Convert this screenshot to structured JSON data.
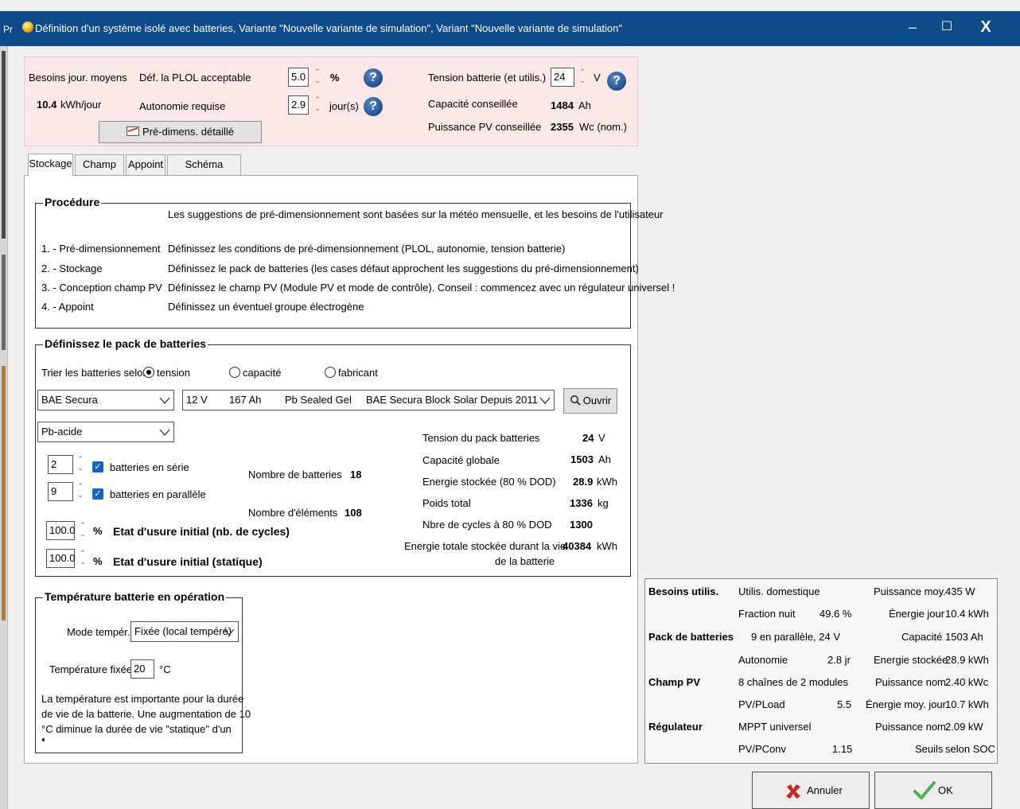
{
  "window": {
    "title": "Définition d'un système isolé avec batteries, Variante  \"Nouvelle variante de simulation\", Variant  \"Nouvelle variante de simulation\"",
    "minimize": "–",
    "maximize": "☐",
    "close": "X",
    "left_clip": "Pr"
  },
  "header": {
    "needs_label": "Besoins jour. moyens",
    "needs_value": "10.4",
    "needs_unit": "kWh/jour",
    "plol_label": "Déf. la PLOL acceptable",
    "plol_value": "5.0",
    "plol_unit": "%",
    "autonomy_label": "Autonomie requise",
    "autonomy_value": "2.9",
    "autonomy_unit": "jour(s)",
    "predim_button": "Pré-dimens. détaillé",
    "voltage_label": "Tension batterie (et utilis.)",
    "voltage_value": "24",
    "voltage_unit": "V",
    "capacity_label": "Capacité conseillée",
    "capacity_value": "1484",
    "capacity_unit": "Ah",
    "pv_label": "Puissance PV conseillée",
    "pv_value": "2355",
    "pv_unit": "Wc (nom.)"
  },
  "tabs": [
    "Stockage",
    "Champ PV",
    "Appoint",
    "Schéma simplifié"
  ],
  "procedure": {
    "legend": "Procédure",
    "intro": "Les suggestions de pré-dimensionnement sont basées sur la météo mensuelle, et les besoins de l'utilisateur",
    "steps": [
      {
        "label": "1. - Pré-dimensionnement",
        "text": "Définissez les conditions de pré-dimensionnement (PLOL, autonomie, tension batterie)"
      },
      {
        "label": "2. - Stockage",
        "text": "Définissez le pack de batteries (les cases défaut approchent les suggestions du pré-dimensionnement)"
      },
      {
        "label": "3. - Conception champ PV",
        "text": "Définissez le champ PV (Module PV et mode de contrôle). Conseil : commencez avec un régulateur universel !"
      },
      {
        "label": "4. - Appoint",
        "text": "Définissez un éventuel groupe électrogène"
      }
    ]
  },
  "battery": {
    "legend": "Définissez le pack de batteries",
    "sort_label": "Trier les batteries selon",
    "sort_options": [
      "tension",
      "capacité",
      "fabricant"
    ],
    "manufacturer": "BAE Secura",
    "model_voltage": "12 V",
    "model_capacity": "167 Ah",
    "model_tech": "Pb  Sealed  Gel",
    "model_name": "BAE Secura Block Solar  Depuis 2011",
    "open_button": "Ouvrir",
    "technology": "Pb-acide",
    "series_value": "2",
    "series_label": "batteries en série",
    "parallel_value": "9",
    "parallel_label": "batteries en parallèle",
    "nb_batteries_label": "Nombre de batteries",
    "nb_batteries_value": "18",
    "nb_elements_label": "Nombre d'éléments",
    "nb_elements_value": "108",
    "wear_cycles_value": "100.0",
    "wear_cycles_unit": "%",
    "wear_cycles_label": "Etat d'usure initial (nb. de cycles)",
    "wear_static_value": "100.0",
    "wear_static_unit": "%",
    "wear_static_label": "Etat d'usure initial (statique)",
    "stats": [
      {
        "label": "Tension du pack batteries",
        "value": "24",
        "unit": "V"
      },
      {
        "label": "Capacité globale",
        "value": "1503",
        "unit": "Ah"
      },
      {
        "label": "Energie stockée (80 % DOD)",
        "value": "28.9",
        "unit": "kWh"
      },
      {
        "label": "Poids total",
        "value": "1336",
        "unit": "kg"
      },
      {
        "label": "Nbre de cycles à 80 % DOD",
        "value": "1300",
        "unit": ""
      }
    ],
    "lifetime_label_1": "Energie totale stockée durant la vie",
    "lifetime_label_2": "de la batterie",
    "lifetime_value": "40384",
    "lifetime_unit": "kWh"
  },
  "temperature": {
    "legend": "Température batterie en opération",
    "mode_label": "Mode tempér.",
    "mode_value": "Fixée (local tempéré)",
    "fixed_label": "Température fixée",
    "fixed_value": "20",
    "fixed_unit": "°C",
    "note_1": "La température est importante pour la durée",
    "note_2": "de vie de la batterie. Une augmentation de 10",
    "note_3": "°C diminue la durée de vie \"statique\" d'un"
  },
  "summary": {
    "needs_title": "Besoins utilis.",
    "needs_type": "Utilis. domestique",
    "avg_power_label": "Puissance moy.",
    "avg_power_value": "435 W",
    "night_label": "Fraction nuit",
    "night_value": "49.6 %",
    "day_energy_label": "Énergie jour",
    "day_energy_value": "10.4 kWh",
    "pack_title": "Pack de batteries",
    "pack_config": "9 en parallèle, 24 V",
    "capacity_label": "Capacité",
    "capacity_value": "1503 Ah",
    "autonomy_label": "Autonomie",
    "autonomy_value": "2.8 jr",
    "stored_label": "Energie stockée",
    "stored_value": "28.9 kWh",
    "pv_title": "Champ PV",
    "pv_config": "8 chaînes de 2 modules",
    "pv_power_label": "Puissance nom.",
    "pv_power_value": "2.40 kWc",
    "pvpload_label": "PV/PLoad",
    "pvpload_value": "5.5",
    "pv_energy_label": "Énergie moy. jour",
    "pv_energy_value": "10.7 kWh",
    "reg_title": "Régulateur",
    "reg_type": "MPPT universel",
    "reg_power_label": "Puissance nom.",
    "reg_power_value": "2.09 kW",
    "pvconv_label": "PV/PConv",
    "pvconv_value": "1.15",
    "thresholds_label": "Seuils",
    "thresholds_value": "selon SOC"
  },
  "footer": {
    "cancel": "Annuler",
    "ok": "OK"
  },
  "colors": {
    "titlebar": "#0f4a8a",
    "header_bg": "#fde8e8",
    "help_icon": "#2a5fa3",
    "checkbox": "#1565c0",
    "cancel_x": "#c62828",
    "ok_check": "#4caf50"
  }
}
